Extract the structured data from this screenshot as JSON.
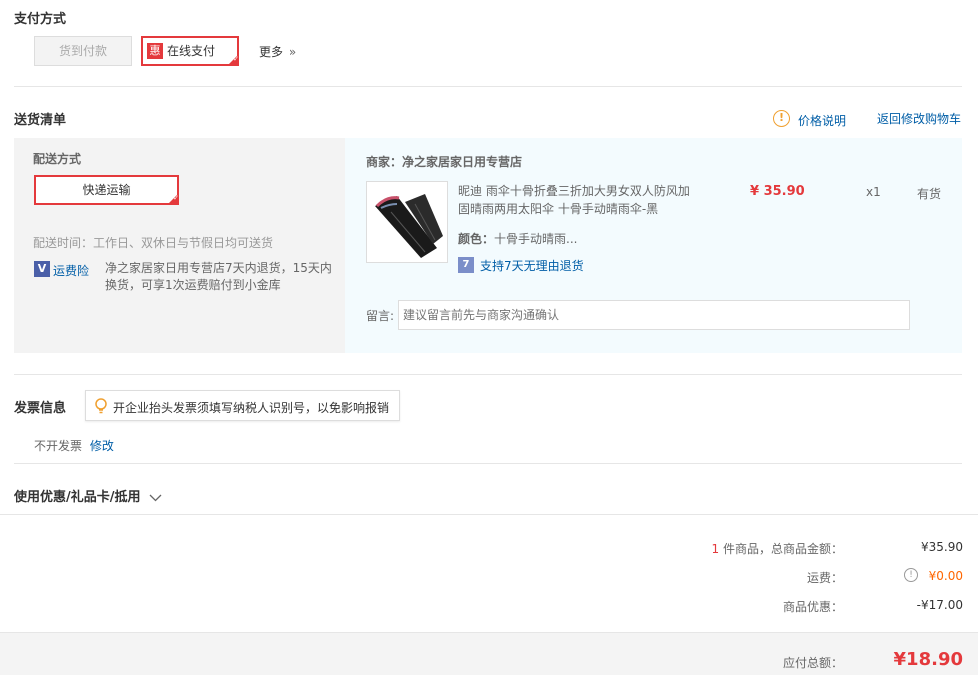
{
  "payment": {
    "title": "支付方式",
    "cod_label": "货到付款",
    "online_badge": "惠",
    "online_label": "在线支付",
    "more_label": "更多",
    "more_chevron": "»"
  },
  "delivery": {
    "title": "送货清单",
    "price_note_label": "价格说明",
    "back_to_cart": "返回修改购物车",
    "method_title": "配送方式",
    "method_selected": "快递运输",
    "time_text": "配送时间：工作日、双休日与节假日均可送货",
    "insurance_badge": "V",
    "insurance_label": "运费险",
    "insurance_desc": "净之家居家日用专营店7天内退货，15天内换货，可享1次运费赔付到小金库",
    "merchant": "商家：净之家居家日用专营店",
    "product": {
      "name": "昵迪 雨伞十骨折叠三折加大男女双人防风加固晴雨两用太阳伞 十骨手动晴雨伞-黑",
      "price": "¥ 35.90",
      "qty": "x1",
      "stock": "有货",
      "color_label": "颜色：",
      "color_value": "十骨手动晴雨...",
      "return_badge": "7",
      "return_policy": "支持7天无理由退货"
    },
    "note_label": "留言:",
    "note_placeholder": "建议留言前先与商家沟通确认"
  },
  "invoice": {
    "title": "发票信息",
    "tip": "开企业抬头发票须填写纳税人识别号，以免影响报销",
    "status": "不开发票",
    "edit_label": "修改"
  },
  "coupon": {
    "title": "使用优惠/礼品卡/抵用"
  },
  "summary": {
    "item_count": "1",
    "items_label": "件商品，总商品金额：",
    "items_total": "¥35.90",
    "shipping_label": "运费：",
    "shipping_value": "¥0.00",
    "discount_label": "商品优惠：",
    "discount_value": "-¥17.00",
    "payable_label": "应付总额：",
    "payable_value": "¥18.90"
  },
  "colors": {
    "accent_red": "#e4393c",
    "link_blue": "#005ea7",
    "delivery_left_bg": "#f3f3f3",
    "delivery_right_bg": "#f3fbfe",
    "footer_bg": "#f4f4f4"
  }
}
